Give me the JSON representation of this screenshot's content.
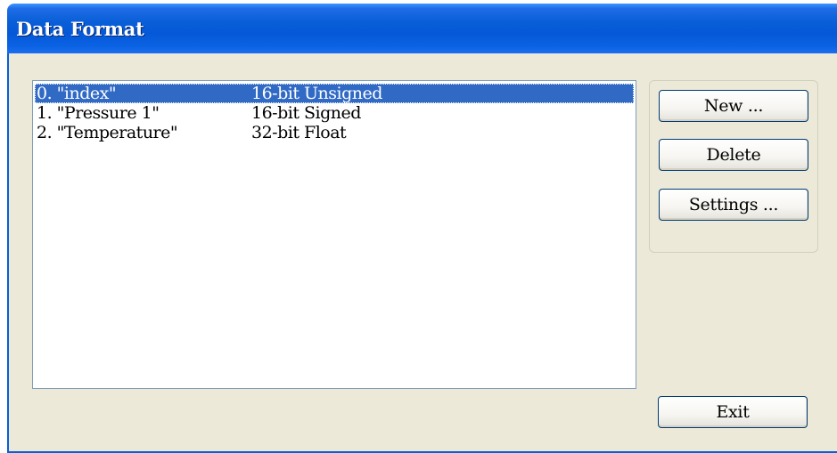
{
  "window": {
    "title": "Data Format"
  },
  "data_list": {
    "items": [
      {
        "name": "0. \"index\"",
        "type": "16-bit Unsigned",
        "selected": true
      },
      {
        "name": "1. \"Pressure 1\"",
        "type": "16-bit Signed",
        "selected": false
      },
      {
        "name": "2. \"Temperature\"",
        "type": "32-bit Float",
        "selected": false
      }
    ]
  },
  "buttons": {
    "new_label": "New ...",
    "delete_label": "Delete",
    "settings_label": "Settings ...",
    "exit_label": "Exit"
  },
  "colors": {
    "titlebar": "#0558d8",
    "selection": "#316ac5",
    "dialog_bg": "#ece9d8"
  }
}
